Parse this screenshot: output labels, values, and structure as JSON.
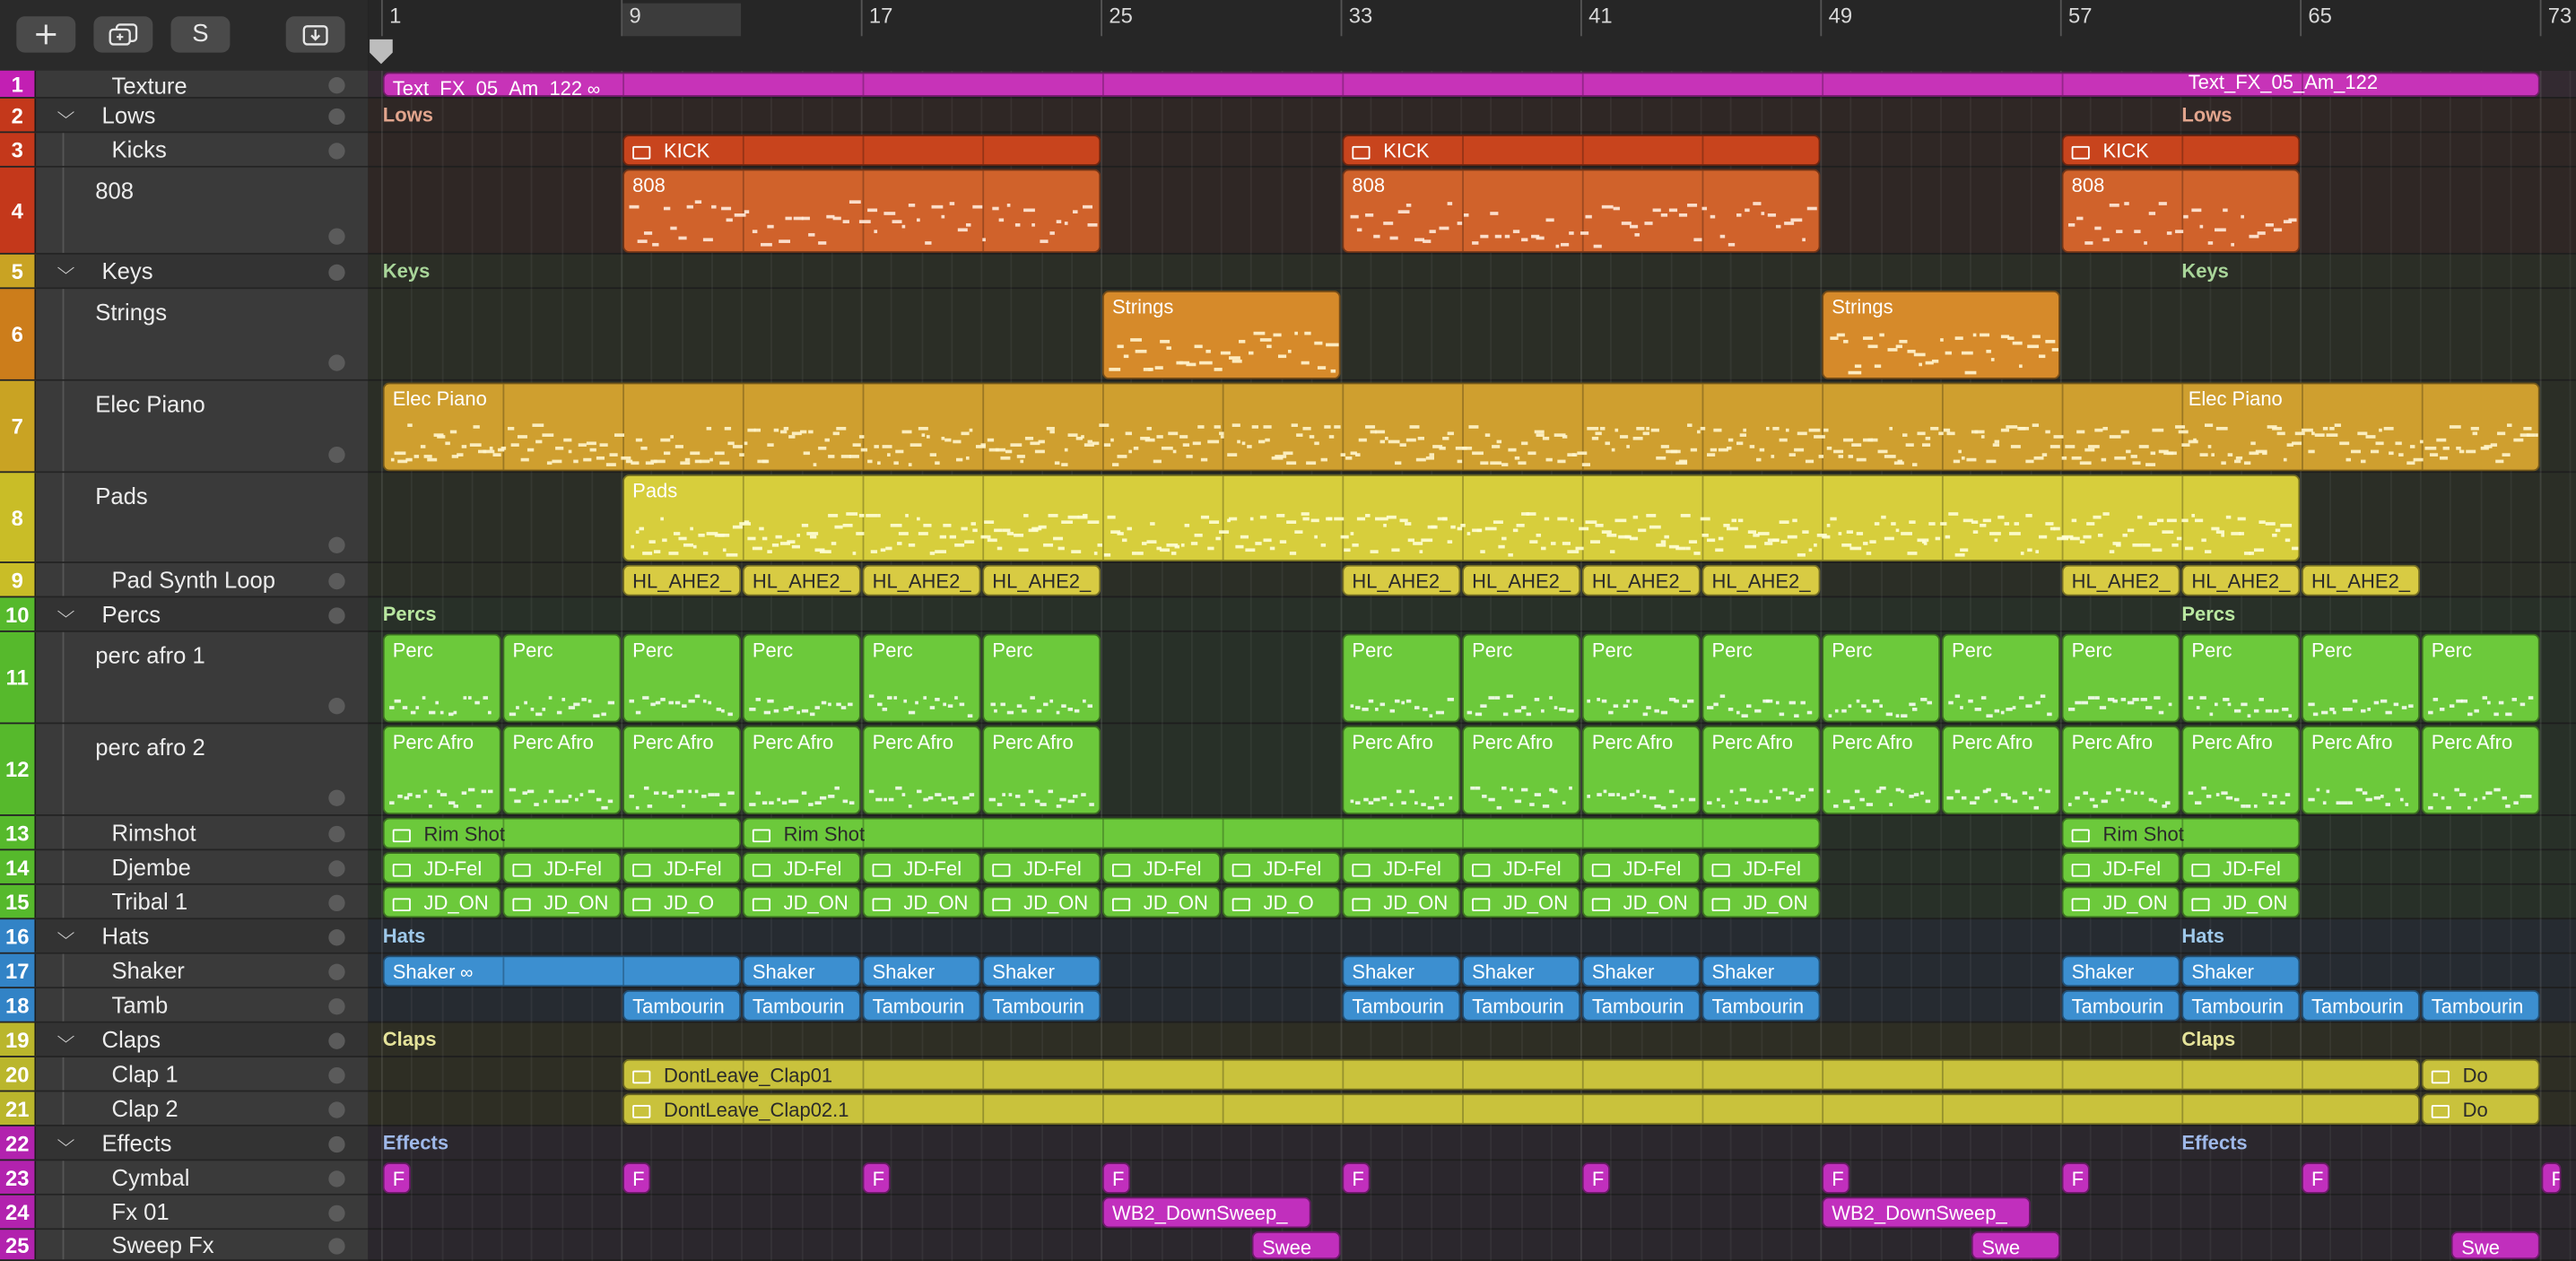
{
  "toolbar": {
    "add_icon": "plus-icon",
    "duplicate_icon": "duplicate-track-icon",
    "s_label": "S",
    "import_icon": "download-tray-icon"
  },
  "ruler": {
    "bars": [
      "1",
      "9",
      "17",
      "25",
      "33",
      "41",
      "49",
      "57",
      "65",
      "73"
    ]
  },
  "colors": {
    "texture": "#c733b8",
    "lows_region": "#c64a21",
    "lows_808": "#d0622b",
    "strings": "#d68a2a",
    "elec_piano": "#cf9f2f",
    "pads": "#d7ce3c",
    "percs": "#6cc93b",
    "hats": "#3c8fd0",
    "claps": "#c9c23c",
    "effects": "#c12fbd"
  },
  "tracks": [
    {
      "num": "1",
      "name": "Texture"
    },
    {
      "num": "2",
      "name": "Lows"
    },
    {
      "num": "3",
      "name": "Kicks"
    },
    {
      "num": "4",
      "name": "808"
    },
    {
      "num": "5",
      "name": "Keys"
    },
    {
      "num": "6",
      "name": "Strings"
    },
    {
      "num": "7",
      "name": "Elec Piano"
    },
    {
      "num": "8",
      "name": "Pads"
    },
    {
      "num": "9",
      "name": "Pad Synth Loop"
    },
    {
      "num": "10",
      "name": "Percs"
    },
    {
      "num": "11",
      "name": "perc afro 1"
    },
    {
      "num": "12",
      "name": "perc afro 2"
    },
    {
      "num": "13",
      "name": "Rimshot"
    },
    {
      "num": "14",
      "name": "Djembe"
    },
    {
      "num": "15",
      "name": "Tribal 1"
    },
    {
      "num": "16",
      "name": "Hats"
    },
    {
      "num": "17",
      "name": "Shaker"
    },
    {
      "num": "18",
      "name": "Tamb"
    },
    {
      "num": "19",
      "name": "Claps"
    },
    {
      "num": "20",
      "name": "Clap 1"
    },
    {
      "num": "21",
      "name": "Clap 2"
    },
    {
      "num": "22",
      "name": "Effects"
    },
    {
      "num": "23",
      "name": "Cymbal"
    },
    {
      "num": "24",
      "name": "Fx 01"
    },
    {
      "num": "25",
      "name": "Sweep Fx"
    }
  ],
  "regions": {
    "texture": "Text_FX_05_Am_122",
    "lows": "Lows",
    "kick": "KICK",
    "r808": "808",
    "keys": "Keys",
    "strings": "Strings",
    "elec_piano": "Elec Piano",
    "pads": "Pads",
    "pad_loop": "HL_AHE2_",
    "percs": "Percs",
    "perc": "Perc",
    "perc_afro": "Perc Afro",
    "rim_shot": "Rim Shot",
    "djembe": "JD-Fel",
    "tribal_long": "JD_ON",
    "tribal_short": "JD_O",
    "hats": "Hats",
    "shaker": "Shaker",
    "tambourine": "Tambourin",
    "claps": "Claps",
    "clap1": "DontLeave_Clap01",
    "clap2": "DontLeave_Clap02.1",
    "clap_short": "Do",
    "effects": "Effects",
    "cymbal": "F",
    "downsweep": "WB2_DownSweep_",
    "sweep_long": "Swee",
    "sweep_short": "Swe"
  }
}
